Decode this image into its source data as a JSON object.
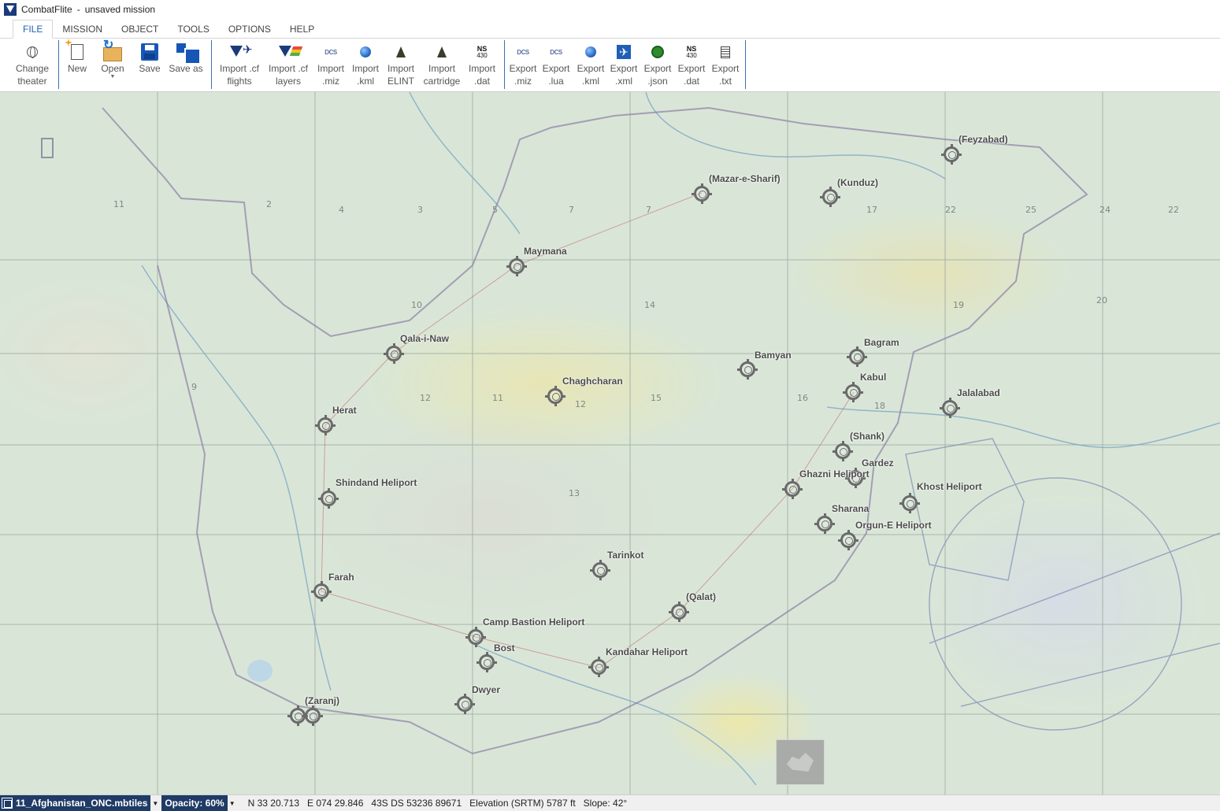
{
  "window": {
    "app_name": "CombatFlite",
    "title_separator": "-",
    "document": "unsaved mission"
  },
  "tabs": [
    {
      "label": "FILE",
      "active": true
    },
    {
      "label": "MISSION",
      "active": false
    },
    {
      "label": "OBJECT",
      "active": false
    },
    {
      "label": "TOOLS",
      "active": false
    },
    {
      "label": "OPTIONS",
      "active": false
    },
    {
      "label": "HELP",
      "active": false
    }
  ],
  "ribbon": {
    "change_theater": "Change\ntheater",
    "new": "New",
    "open": "Open",
    "save": "Save",
    "save_as": "Save as",
    "import_cf_flights": "Import .cf\nflights",
    "import_cf_layers": "Import .cf\nlayers",
    "import_miz": "Import\n.miz",
    "import_kml": "Import\n.kml",
    "import_elint": "Import\nELINT",
    "import_cartridge": "Import\ncartridge",
    "import_dat": "Import\n.dat",
    "export_miz": "Export\n.miz",
    "export_lua": "Export\n.lua",
    "export_kml": "Export\n.kml",
    "export_xml": "Export\n.xml",
    "export_json": "Export\n.json",
    "export_dat": "Export\n.dat",
    "export_txt": "Export\n.txt",
    "icon_text_dcs": "DCS",
    "icon_text_ns": "NS",
    "icon_text_430": "430"
  },
  "map": {
    "airfields": [
      "(Feyzabad)",
      "(Mazar-e-Sharif)",
      "(Kunduz)",
      "Maymana",
      "Qala-i-Naw",
      "Bamyan",
      "Bagram",
      "Kabul",
      "Chaghcharan",
      "Jalalabad",
      "Herat",
      "(Shank)",
      "Gardez",
      "Ghazni Heliport",
      "Shindand Heliport",
      "Khost Heliport",
      "Sharana",
      "Orgun-E Heliport",
      "Tarinkot",
      "Farah",
      "(Qalat)",
      "Camp Bastion Heliport",
      "Bost",
      "Kandahar Heliport",
      "Dwyer",
      "(Zaranj)"
    ],
    "grid_labels": [
      "11",
      "2",
      "3",
      "4",
      "5",
      "7",
      "7",
      "9",
      "10",
      "12",
      "11",
      "12",
      "13",
      "14",
      "15",
      "16",
      "17",
      "18",
      "19",
      "20",
      "22",
      "25",
      "24",
      "22"
    ]
  },
  "statusbar": {
    "theater": "11_Afghanistan_ONC.mbtiles",
    "opacity": "Opacity: 60%",
    "coords": "N 33 20.713   E 074 29.846   43S DS 53236 89671   Elevation (SRTM) 5787 ft   Slope: 42°"
  },
  "colors": {
    "accent": "#1f5fb8",
    "status_dark": "#1f3b66",
    "map_base": "#d9e6d7",
    "waypoint": "#6a6a6a"
  },
  "icons": [
    "globe-icon",
    "new-file-icon",
    "open-folder-icon",
    "save-icon",
    "save-as-icon",
    "cf-flights-icon",
    "cf-layers-icon",
    "dcs-icon",
    "google-earth-icon",
    "elint-icon",
    "cartridge-icon",
    "ns430-icon",
    "xml-icon",
    "json-icon",
    "txt-icon"
  ]
}
